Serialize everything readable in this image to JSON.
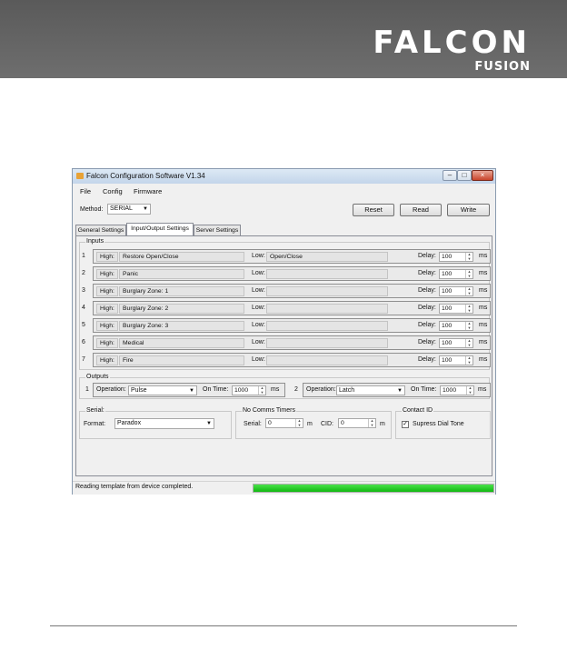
{
  "brand": {
    "name": "FALCON",
    "sub": "FUSION"
  },
  "window": {
    "title": "Falcon Configuration Software V1.34",
    "controls": {
      "minimize": "–",
      "maximize": "□",
      "close": "×"
    }
  },
  "menu": [
    "File",
    "Config",
    "Firmware"
  ],
  "method": {
    "label": "Method:",
    "value": "SERIAL"
  },
  "buttons": {
    "reset": "Reset",
    "read": "Read",
    "write": "Write"
  },
  "tabs": [
    {
      "label": "General Settings",
      "active": false
    },
    {
      "label": "Input/Output Settings",
      "active": true
    },
    {
      "label": "Server Settings",
      "active": false
    }
  ],
  "inputs": {
    "title": "Inputs",
    "high_label": "High:",
    "low_label": "Low:",
    "delay_label": "Delay:",
    "unit": "ms",
    "rows": [
      {
        "num": "1",
        "high": "Restore Open/Close",
        "low": "Open/Close",
        "delay": "100"
      },
      {
        "num": "2",
        "high": "Panic",
        "low": "",
        "delay": "100"
      },
      {
        "num": "3",
        "high": "Burglary Zone: 1",
        "low": "",
        "delay": "100"
      },
      {
        "num": "4",
        "high": "Burglary Zone: 2",
        "low": "",
        "delay": "100"
      },
      {
        "num": "5",
        "high": "Burglary Zone: 3",
        "low": "",
        "delay": "100"
      },
      {
        "num": "6",
        "high": "Medical",
        "low": "",
        "delay": "100"
      },
      {
        "num": "7",
        "high": "Fire",
        "low": "",
        "delay": "100"
      }
    ]
  },
  "outputs": {
    "title": "Outputs",
    "operation_label": "Operation:",
    "ontime_label": "On Time:",
    "unit": "ms",
    "items": [
      {
        "num": "1",
        "operation": "Pulse",
        "on_time": "1000"
      },
      {
        "num": "2",
        "operation": "Latch",
        "on_time": "1000"
      }
    ]
  },
  "serial": {
    "title": "Serial:",
    "format_label": "Format:",
    "format": "Paradox"
  },
  "no_comms": {
    "title": "No Comms Timers",
    "serial_label": "Serial:",
    "serial_value": "0",
    "serial_unit": "m",
    "cid_label": "CID:",
    "cid_value": "0",
    "cid_unit": "m"
  },
  "contact_id": {
    "title": "Contact ID",
    "checkbox_label": "Supress Dial Tone",
    "checked": true
  },
  "status": {
    "text": "Reading template from device completed.",
    "progress": 1.0
  }
}
